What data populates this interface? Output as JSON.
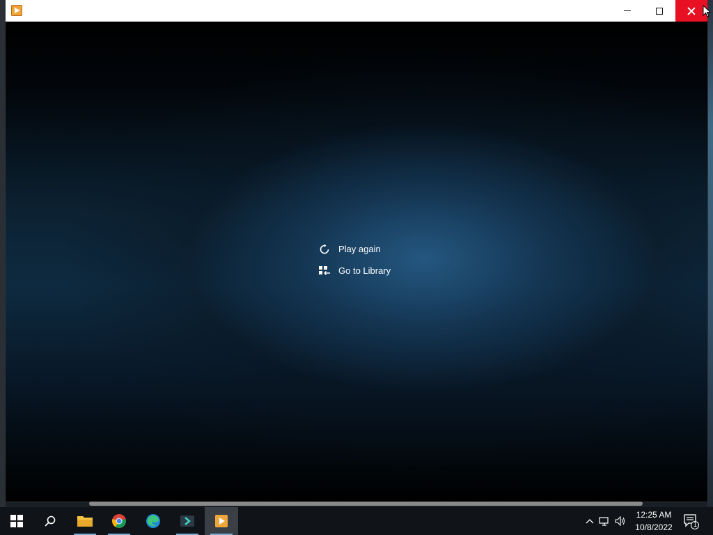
{
  "window": {
    "title": "",
    "controls": {
      "minimize_icon": "minimize-icon",
      "maximize_icon": "maximize-icon",
      "close_icon": "close-icon"
    }
  },
  "player": {
    "menu": [
      {
        "label": "Play again",
        "icon": "replay-icon"
      },
      {
        "label": "Go to Library",
        "icon": "library-icon"
      }
    ]
  },
  "taskbar": {
    "apps": [
      {
        "name": "start",
        "icon": "windows-icon"
      },
      {
        "name": "search",
        "icon": "search-icon"
      },
      {
        "name": "file-explorer",
        "icon": "folder-icon"
      },
      {
        "name": "chrome",
        "icon": "chrome-icon"
      },
      {
        "name": "edge",
        "icon": "edge-icon"
      },
      {
        "name": "app",
        "icon": "app-icon"
      },
      {
        "name": "media-player",
        "icon": "media-player-icon",
        "active": true
      }
    ],
    "clock": {
      "time": "12:25 AM",
      "date": "10/8/2022"
    },
    "notification_count": "1"
  },
  "colors": {
    "close_button": "#e81123",
    "taskbar": "#101418",
    "active_underline": "#78aedc"
  }
}
